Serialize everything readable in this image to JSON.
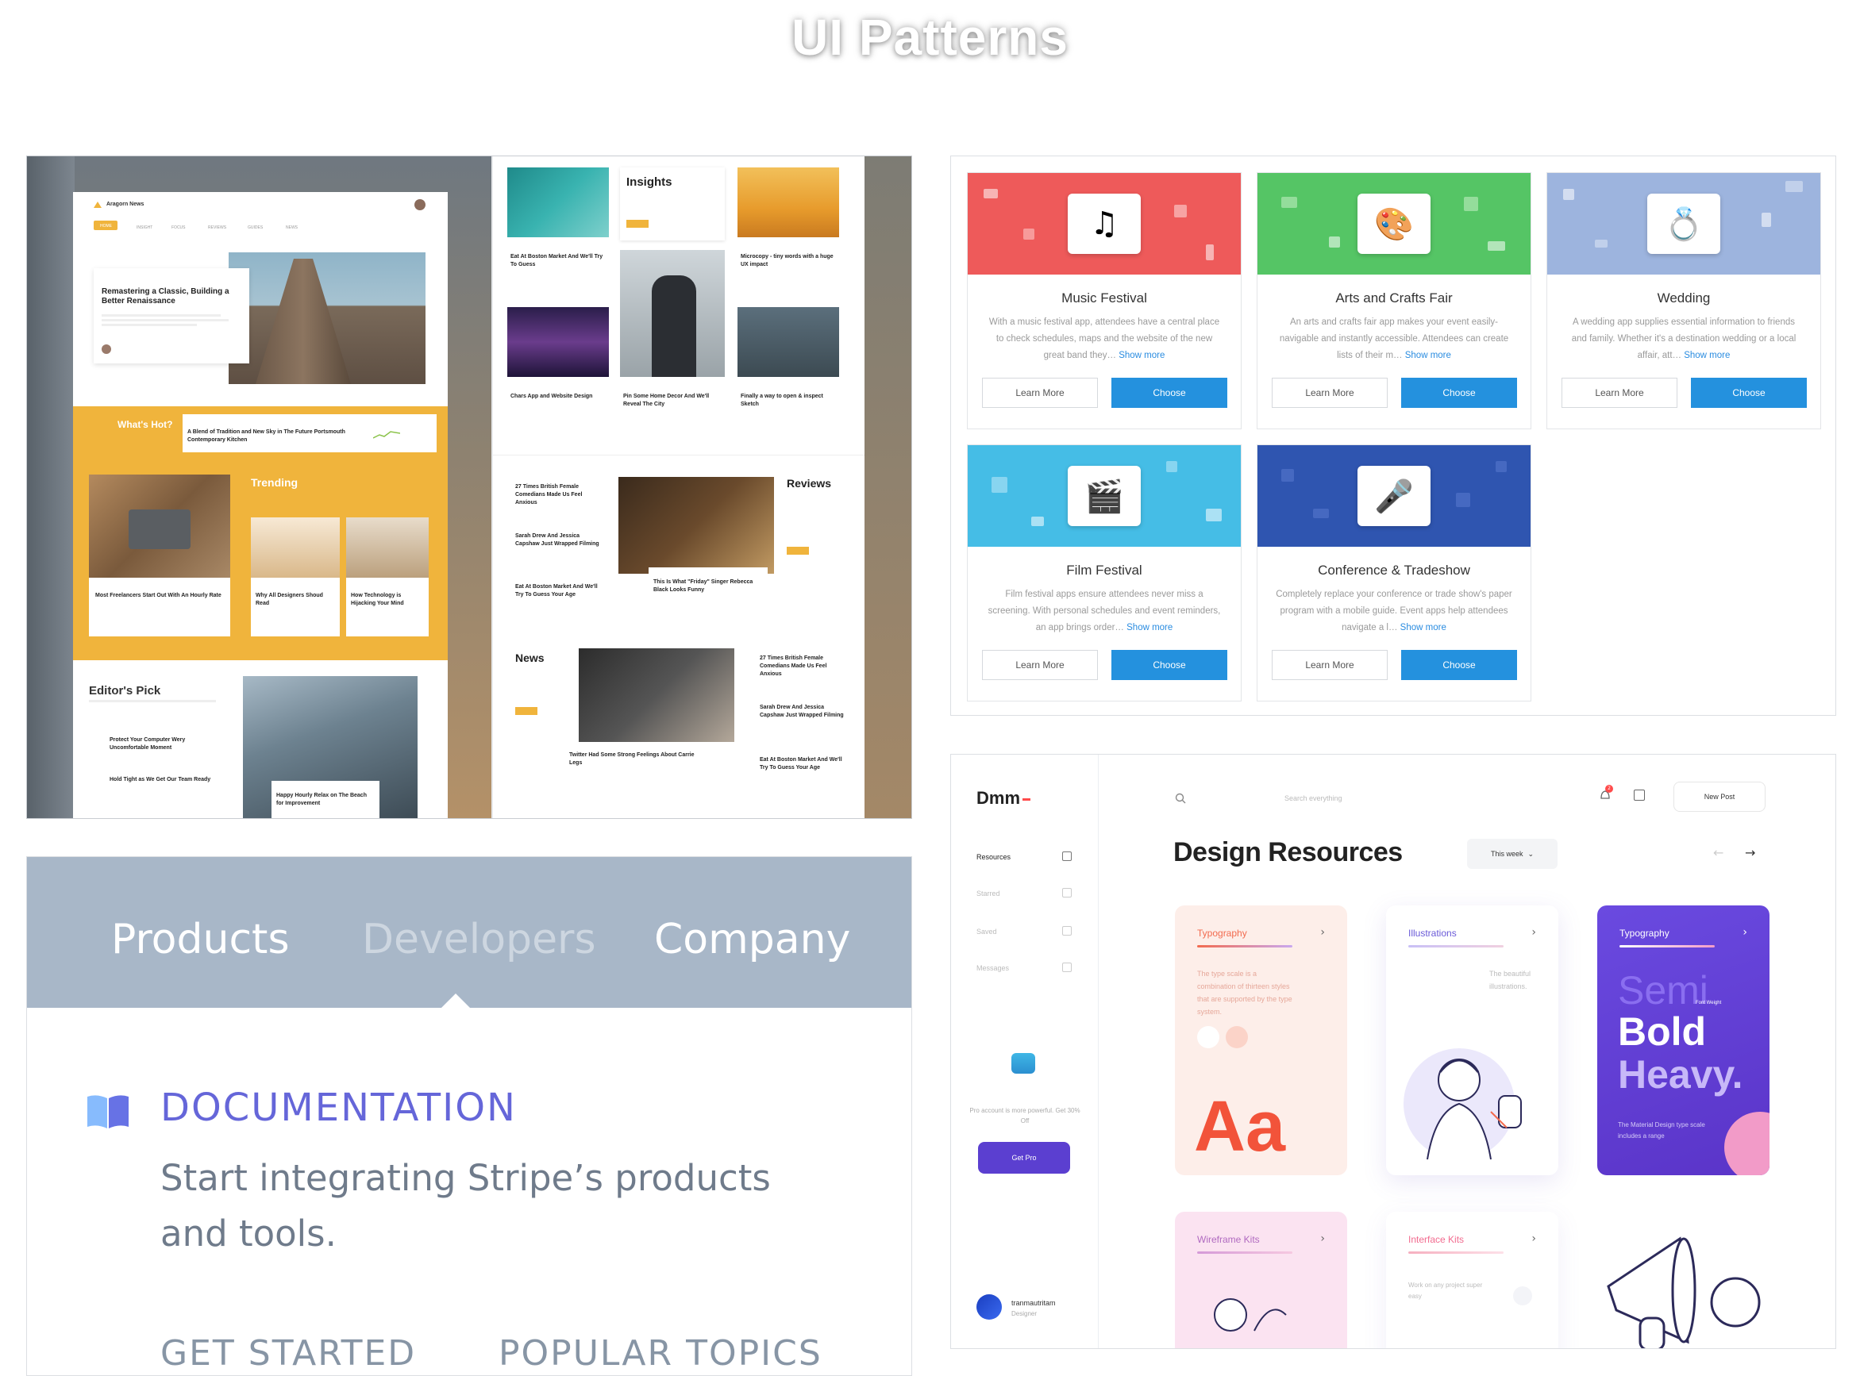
{
  "page": {
    "title": "UI Patterns"
  },
  "news": {
    "site_name": "Aragorn News",
    "nav": [
      "HOME",
      "INSIGHT",
      "FOCUS",
      "REVIEWS",
      "GUIDES",
      "NEWS"
    ],
    "hero_title": "Remastering a Classic, Building a Better Renaissance",
    "whats_hot": "What's Hot?",
    "hot_item": "A Blend of Tradition and New Sky in The Future Portsmouth Contemporary Kitchen",
    "trending": "Trending",
    "trending_items": [
      "Most Freelancers Start Out With An Hourly Rate",
      "Why All Designers Shoud Read",
      "How Technology is Hijacking Your Mind"
    ],
    "editors_pick": "Editor's Pick",
    "editors_items": [
      "Protect Your Computer Wery Uncomfortable Moment",
      "Hold Tight as We Get Our Team Ready"
    ],
    "editors_feature": "Happy Hourly Relax on The Beach for Improvement",
    "insights": "Insights",
    "grid_items": [
      "Eat At Boston Market And We'll Try To Guess",
      "Microcopy - tiny words with a huge UX impact",
      "Chars App and Website Design",
      "Pin Some Home Decor And We'll Reveal The City",
      "Finally a way to open & inspect Sketch"
    ],
    "reviews": "Reviews",
    "review_list": [
      "27 Times British Female Comedians Made Us Feel Anxious",
      "Sarah Drew And Jessica Capshaw Just Wrapped Filming",
      "Eat At Boston Market And We'll Try To Guess Your Age"
    ],
    "review_feature": "This Is What \"Friday\" Singer Rebecca Black Looks Funny",
    "news": "News",
    "news_feature": "Twitter Had Some Strong Feelings About Carrie Legs",
    "news_list": [
      "27 Times British Female Comedians Made Us Feel Anxious",
      "Sarah Drew And Jessica Capshaw Just Wrapped Filming",
      "Eat At Boston Market And We'll Try To Guess Your Age"
    ]
  },
  "events": {
    "learn_label": "Learn More",
    "choose_label": "Choose",
    "show_more": "Show more",
    "cards": [
      {
        "title": "Music Festival",
        "desc": "With a music festival app, attendees have a central place to check schedules, maps and the website of the new great band they…",
        "color": "#ee5a5a",
        "icon": "music-note-icon",
        "glyph": "♫"
      },
      {
        "title": "Arts and Crafts Fair",
        "desc": "An arts and crafts fair app makes your event easily-navigable and instantly accessible. Attendees can create lists of their m…",
        "color": "#55c565",
        "icon": "palette-icon",
        "glyph": "🎨"
      },
      {
        "title": "Wedding",
        "desc": "A wedding app supplies essential information to friends and family. Whether it's a destination wedding or a local affair, att…",
        "color": "#9db4de",
        "icon": "ring-icon",
        "glyph": "💍"
      },
      {
        "title": "Film Festival",
        "desc": "Film festival apps ensure attendees never miss a screening. With personal schedules and event reminders, an app brings order…",
        "color": "#45bde6",
        "icon": "clapperboard-icon",
        "glyph": "🎬"
      },
      {
        "title": "Conference & Tradeshow",
        "desc": "Completely replace your conference or trade show's paper program with a mobile guide. Event apps help attendees navigate a l…",
        "color": "#2f55b0",
        "icon": "podium-icon",
        "glyph": "🎤"
      }
    ]
  },
  "stripe": {
    "tabs": [
      "Products",
      "Developers",
      "Company"
    ],
    "doc_title": "DOCUMENTATION",
    "doc_desc": "Start integrating Stripe’s products and tools.",
    "links": [
      "GET STARTED",
      "POPULAR TOPICS"
    ]
  },
  "dmm": {
    "logo": "Dmm",
    "search_placeholder": "Search everything",
    "new_post": "New Post",
    "sidebar": [
      "Resources",
      "Starred",
      "Saved",
      "Messages"
    ],
    "promo": "Pro account is more powerful. Get 30% Off",
    "get_pro": "Get Pro",
    "user": "tranmautritam",
    "user_role": "Designer",
    "title": "Design Resources",
    "filter": "This week",
    "notif_count": "2",
    "cards": [
      {
        "label": "Typography",
        "desc": "The type scale is a combination of thirteen styles that are supported by the type system.",
        "big": "Aa"
      },
      {
        "label": "Illustrations",
        "desc": "The beautiful illustrations."
      },
      {
        "label": "Typography",
        "semi": "Semi",
        "bold": "Bold",
        "heavy": "Heavy.",
        "weight_tip": "Font Weight",
        "desc": "The Material Design type scale includes a range"
      },
      {
        "label": "Wireframe Kits"
      },
      {
        "label": "Interface Kits",
        "desc": "Work on any project super easy"
      }
    ]
  }
}
